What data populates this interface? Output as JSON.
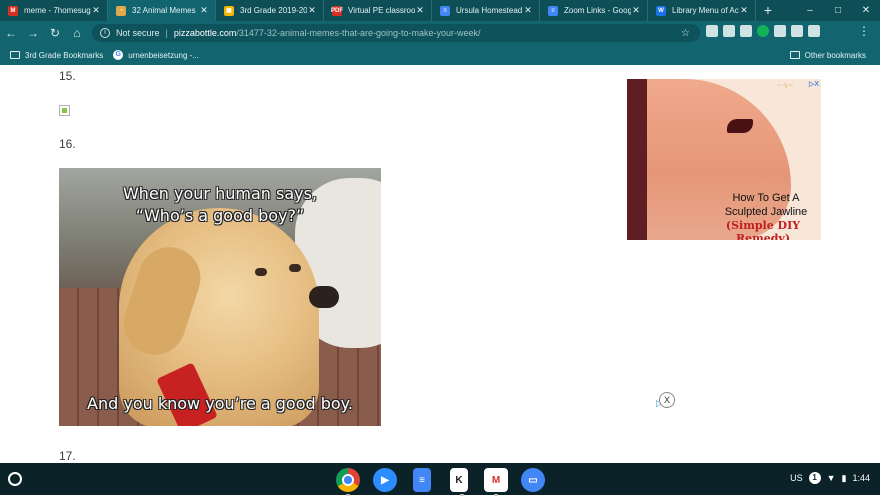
{
  "browser": {
    "tabs": [
      {
        "title": "meme - 7homesug",
        "favicon": "gmail-icon",
        "color": "#d93025"
      },
      {
        "title": "32 Animal Memes",
        "favicon": "pizzabottle-icon",
        "color": "#e2a84a",
        "active": true
      },
      {
        "title": "3rd Grade 2019-20",
        "favicon": "classroom-icon",
        "color": "#f4b400"
      },
      {
        "title": "Virtual PE classroo",
        "favicon": "pdf-icon",
        "color": "#d93025"
      },
      {
        "title": "Ursula Homestead",
        "favicon": "docs-icon",
        "color": "#4285f4"
      },
      {
        "title": "Zoom Links - Goog",
        "favicon": "docs-icon",
        "color": "#4285f4"
      },
      {
        "title": "Library Menu of Ac",
        "favicon": "w-icon",
        "color": "#1a73e8"
      }
    ],
    "new_tab_label": "+",
    "window_controls": {
      "minimize": "–",
      "maximize": "□",
      "close": "✕"
    },
    "nav": {
      "back": "←",
      "forward": "→",
      "reload": "↻",
      "home": "⌂"
    },
    "omnibox": {
      "security_text": "Not secure",
      "host": "pizzabottle.com",
      "path": "/31477-32-animal-memes-that-are-going-to-make-your-week/"
    },
    "bookmarks": {
      "left_1": "3rd Grade Bookmarks",
      "left_2": "urnenbeisetzung -...",
      "right": "Other bookmarks"
    }
  },
  "page": {
    "number_15": "15.",
    "number_16": "16.",
    "number_17": "17.",
    "meme": {
      "caption_top_1": "When your human says,",
      "caption_top_2": "“Who’s a good boy?”",
      "caption_bottom": "And you know you’re a good boy."
    },
    "ad": {
      "title_line_1": "How To Get A",
      "title_line_2": "Sculpted Jawline",
      "subtitle": "(Simple DIY Remedy)",
      "adx_label": "▷X"
    }
  },
  "shelf": {
    "apps": [
      {
        "name": "chrome-app",
        "color": "#f1f3f4"
      },
      {
        "name": "zoom-app",
        "color": "#2d8cff"
      },
      {
        "name": "docs-app",
        "color": "#4285f4"
      },
      {
        "name": "keep-app",
        "color": "#ffffff"
      },
      {
        "name": "gmail-app",
        "color": "#ffffff"
      },
      {
        "name": "files-app",
        "color": "#4285f4"
      }
    ],
    "status": {
      "input": "US",
      "notifications": "1",
      "time": "1:44"
    }
  }
}
